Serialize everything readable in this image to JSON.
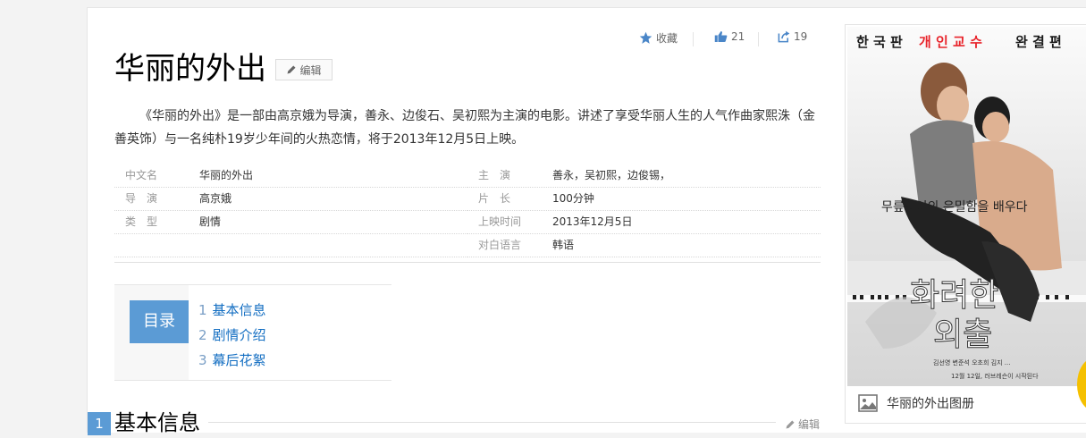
{
  "toolbar": {
    "favorite_label": "收藏",
    "like_count": "21",
    "share_count": "19"
  },
  "page_title": "华丽的外出",
  "edit_label": "编辑",
  "summary": "《华丽的外出》是一部由高京娥为导演，善永、边俊石、吴初熙为主演的电影。讲述了享受华丽人生的人气作曲家熙洙（金善英饰）与一名纯朴19岁少年间的火热恋情，将于2013年12月5日上映。",
  "info_left": [
    {
      "label": "中文名",
      "value": "华丽的外出"
    },
    {
      "label": "导　演",
      "value": "高京娥"
    },
    {
      "label": "类　型",
      "value": "剧情"
    }
  ],
  "info_right": [
    {
      "label": "主　演",
      "value": "善永，吴初熙，边俊锡，"
    },
    {
      "label": "片　长",
      "value": "100分钟"
    },
    {
      "label": "上映时间",
      "value": "2013年12月5日"
    },
    {
      "label": "对白语言",
      "value": "韩语"
    }
  ],
  "toc": {
    "badge": "目录",
    "items": [
      {
        "num": "1",
        "label": "基本信息"
      },
      {
        "num": "2",
        "label": "剧情介绍"
      },
      {
        "num": "3",
        "label": "幕后花絮"
      }
    ]
  },
  "section": {
    "num": "1",
    "title": "基本信息",
    "edit_label": "编辑"
  },
  "poster": {
    "top_text_a": "한 국 판",
    "top_text_b": "개 인 교 수",
    "top_text_c": "완 결 편",
    "tagline": "무릎사이의 은밀함을 배우다",
    "title_line1": "화려한",
    "title_line2": "외출",
    "credits": "김선영 변준석 오초희 김지 ...",
    "release": "12월 12일, 러브레슨이 시작된다",
    "colors": {
      "accent": "#e8242b",
      "dark": "#1a1a1a"
    }
  },
  "sidebar": {
    "album_label": "华丽的外出图册"
  },
  "colors": {
    "link": "#136ec2",
    "badge": "#5b9bd5"
  }
}
